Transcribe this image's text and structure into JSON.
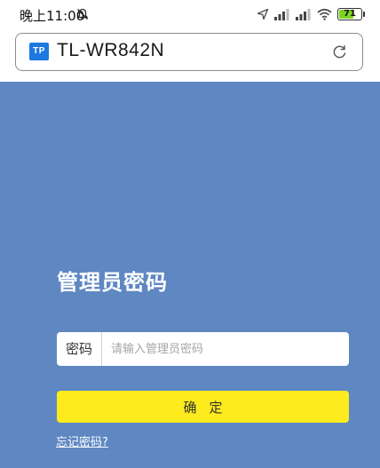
{
  "status_bar": {
    "time": "晚上11:00",
    "battery_level": "71",
    "battery_fraction": 0.71,
    "icons": [
      "mute-icon",
      "location-icon",
      "signal-icon",
      "signal-icon",
      "wifi-icon",
      "battery-icon"
    ]
  },
  "address_bar": {
    "logo_text": "TP",
    "url": "TL-WR842N",
    "logo_color": "#1d79e0"
  },
  "login": {
    "title": "管理员密码",
    "password_label": "密码",
    "password_placeholder": "请输入管理员密码",
    "password_value": "",
    "confirm_label": "确定",
    "forgot_label": "忘记密码?"
  },
  "colors": {
    "page_background": "#5f87c2",
    "button_background": "#fdeb1d",
    "text_on_background": "#ffffff"
  }
}
